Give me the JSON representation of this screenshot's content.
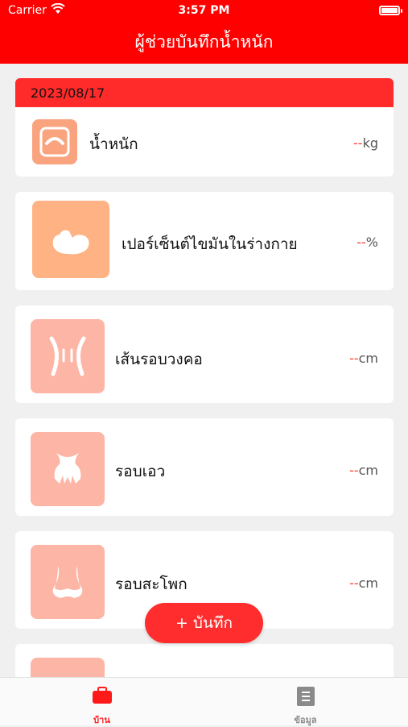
{
  "status_bar": {
    "carrier": "Carrier",
    "time": "3:57 PM"
  },
  "header": {
    "title": "ผู้ช่วยบันทึกน้ำหนัก"
  },
  "date": "2023/08/17",
  "metrics": [
    {
      "label": "น้ำหนัก",
      "dash": "--",
      "unit": "kg",
      "icon": "scale-icon",
      "color": "#f9a47e"
    },
    {
      "label": "เปอร์เซ็นต์ไขมันในร่างกาย",
      "dash": "--",
      "unit": "%",
      "icon": "bicep-icon",
      "color": "#ffb283"
    },
    {
      "label": "เส้นรอบวงคอ",
      "dash": "--",
      "unit": "cm",
      "icon": "neck-icon",
      "color": "#fdb5a5"
    },
    {
      "label": "รอบเอว",
      "dash": "--",
      "unit": "cm",
      "icon": "waist-icon",
      "color": "#fdb5a5"
    },
    {
      "label": "รอบสะโพก",
      "dash": "--",
      "unit": "cm",
      "icon": "hip-icon",
      "color": "#fdb5a5"
    }
  ],
  "fab": {
    "label": "+ บันทึก"
  },
  "tabs": [
    {
      "label": "บ้าน",
      "icon": "home-toolbox-icon",
      "color": "#ff1a1a"
    },
    {
      "label": "ข้อมูล",
      "icon": "document-icon",
      "color": "#8a8a8a"
    }
  ]
}
